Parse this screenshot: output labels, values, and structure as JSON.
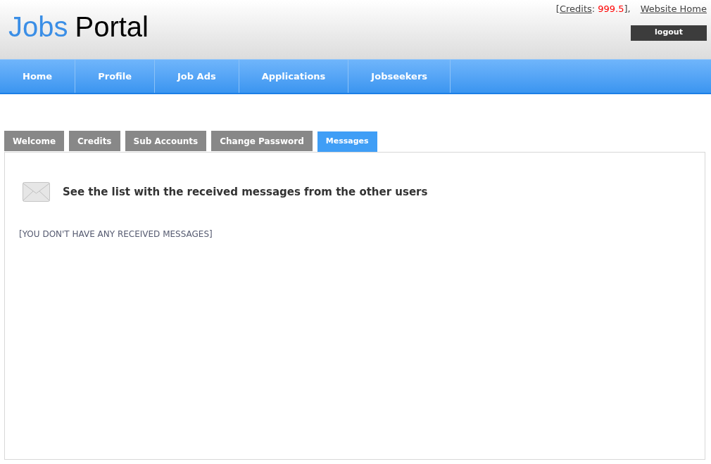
{
  "logo": {
    "first": "Jobs",
    "second": "Portal"
  },
  "header": {
    "credits_open": "[",
    "credits_link": "Credits",
    "credits_sep": ":",
    "credits_value": "999.5",
    "credits_close": "],",
    "website_home": "Website Home",
    "logout": "logout"
  },
  "nav": [
    {
      "label": "Home"
    },
    {
      "label": "Profile"
    },
    {
      "label": "Job Ads"
    },
    {
      "label": "Applications"
    },
    {
      "label": "Jobseekers"
    }
  ],
  "tabs": [
    {
      "label": "Welcome",
      "selected": false
    },
    {
      "label": "Credits",
      "selected": false
    },
    {
      "label": "Sub Accounts",
      "selected": false
    },
    {
      "label": "Change Password",
      "selected": false
    },
    {
      "label": "Messages",
      "selected": true
    }
  ],
  "panel": {
    "heading": "See the list with the received messages from the other users",
    "empty_note": "[YOU DON'T HAVE ANY RECEIVED MESSAGES]"
  }
}
